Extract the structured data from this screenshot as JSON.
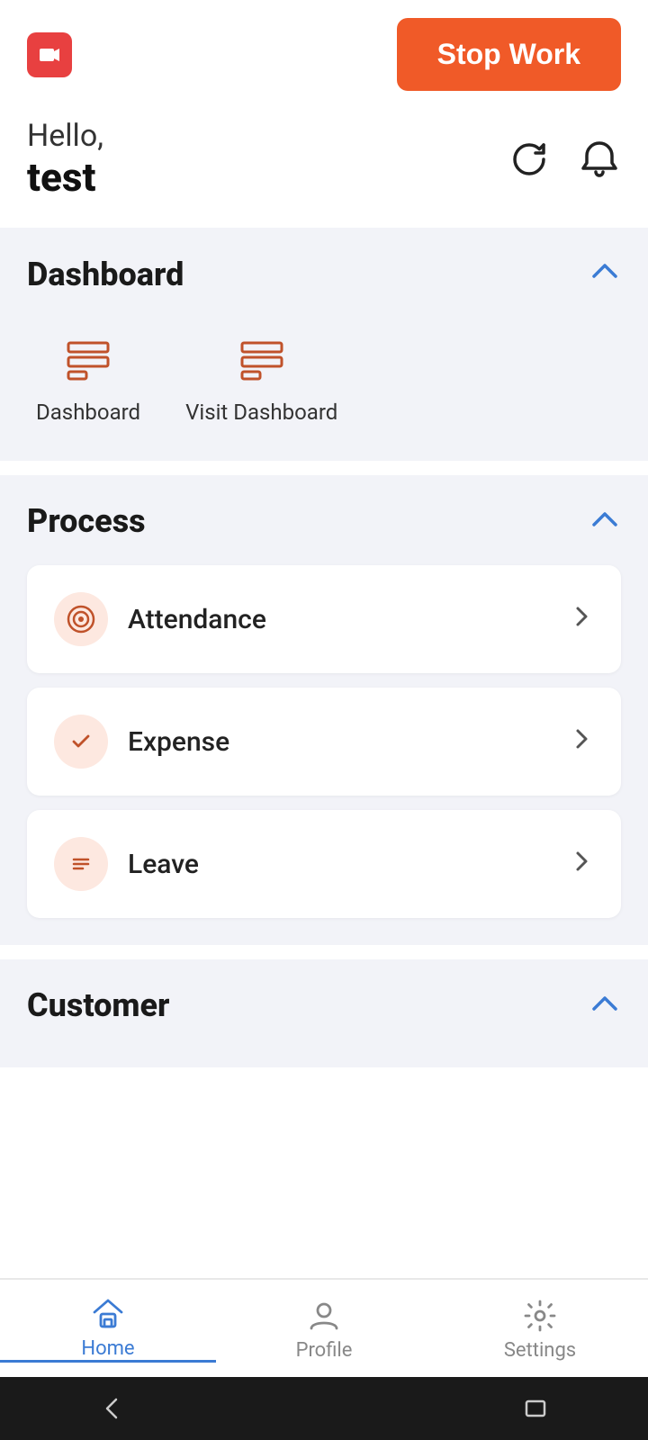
{
  "topBar": {
    "recordIconLabel": "record-icon",
    "stopWorkLabel": "Stop Work"
  },
  "greeting": {
    "hello": "Hello,",
    "userName": "test"
  },
  "headerIcons": {
    "refresh": "refresh-icon",
    "bell": "bell-icon"
  },
  "dashboardSection": {
    "title": "Dashboard",
    "items": [
      {
        "id": "dashboard",
        "label": "Dashboard"
      },
      {
        "id": "visit-dashboard",
        "label": "Visit Dashboard"
      }
    ]
  },
  "processSection": {
    "title": "Process",
    "items": [
      {
        "id": "attendance",
        "label": "Attendance",
        "icon": "target-icon"
      },
      {
        "id": "expense",
        "label": "Expense",
        "icon": "check-icon"
      },
      {
        "id": "leave",
        "label": "Leave",
        "icon": "menu-icon"
      }
    ]
  },
  "customerSection": {
    "title": "Customer"
  },
  "bottomNav": {
    "items": [
      {
        "id": "home",
        "label": "Home",
        "active": true
      },
      {
        "id": "profile",
        "label": "Profile",
        "active": false
      },
      {
        "id": "settings",
        "label": "Settings",
        "active": false
      }
    ]
  }
}
